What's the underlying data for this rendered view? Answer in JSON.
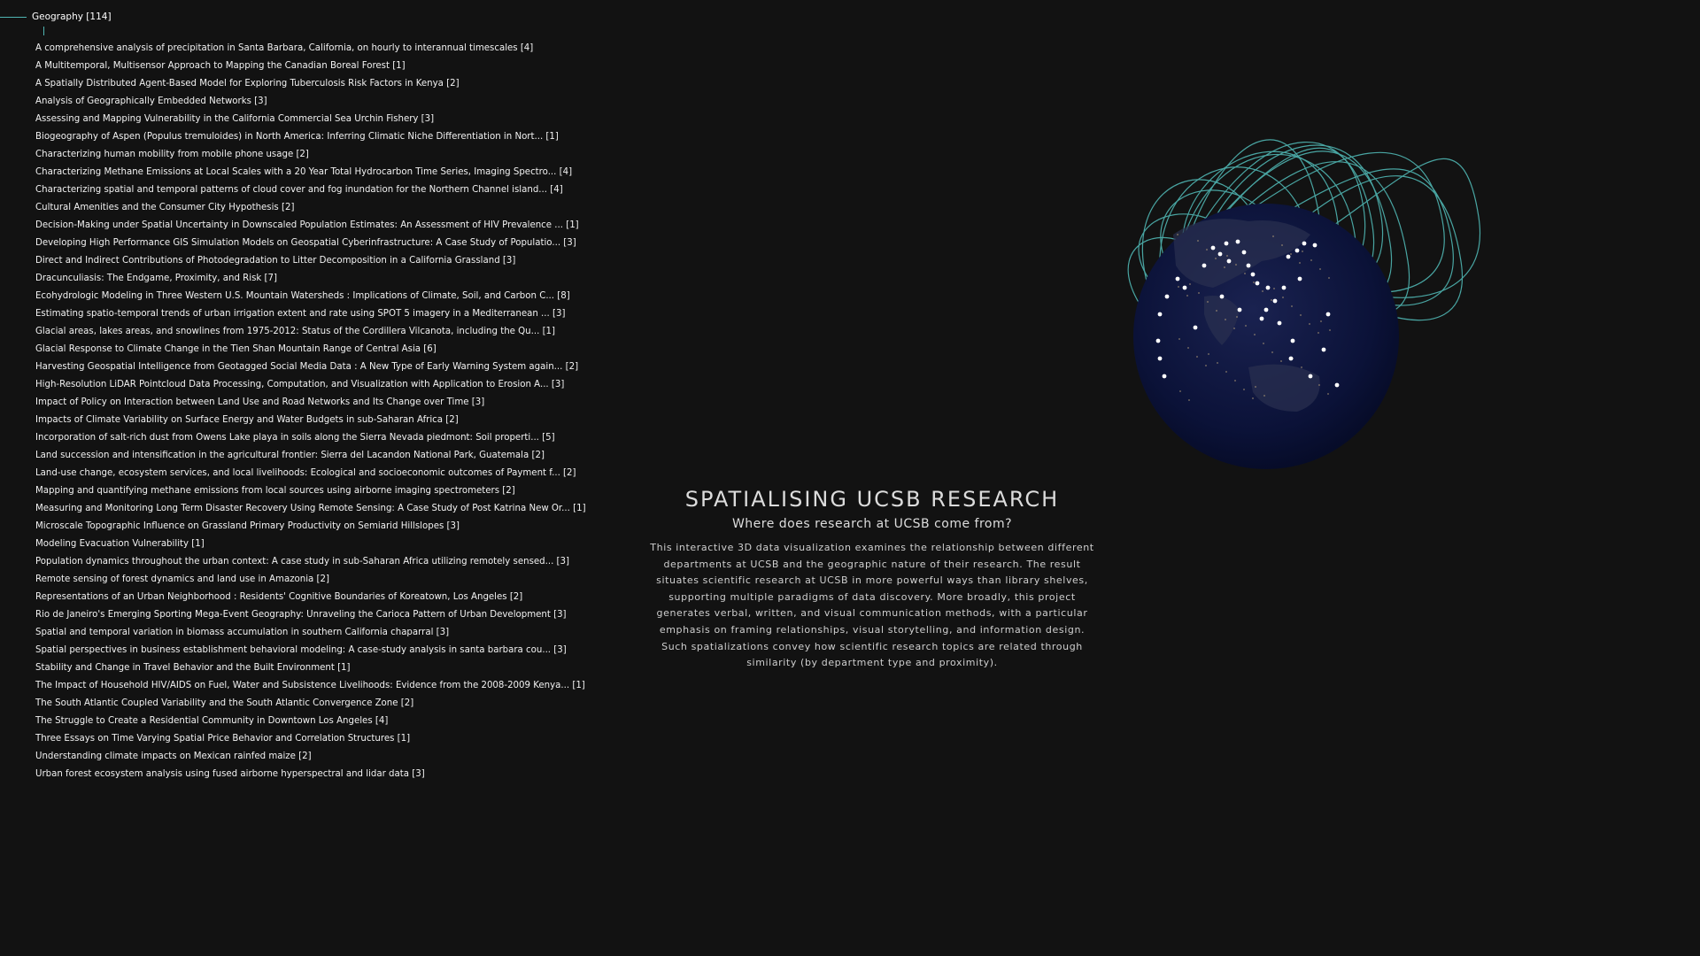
{
  "tree": {
    "header_label": "Geography [114]",
    "items": [
      "A comprehensive analysis of precipitation in Santa Barbara, California, on hourly to interannual timescales [4]",
      "A Multitemporal, Multisensor Approach to Mapping the Canadian Boreal Forest [1]",
      "A Spatially Distributed Agent-Based Model for Exploring Tuberculosis Risk Factors in Kenya [2]",
      "Analysis of Geographically Embedded Networks [3]",
      "Assessing and Mapping Vulnerability in the California Commercial Sea Urchin Fishery [3]",
      "Biogeography of Aspen (Populus tremuloides) in North America: Inferring Climatic Niche Differentiation in Nort... [1]",
      "Characterizing human mobility from mobile phone usage [2]",
      "Characterizing Methane Emissions at Local Scales with a 20 Year Total Hydrocarbon Time Series, Imaging Spectro... [4]",
      "Characterizing spatial and temporal patterns of cloud cover and fog inundation for the Northern Channel island... [4]",
      "Cultural Amenities and the Consumer City Hypothesis [2]",
      "Decision-Making under Spatial Uncertainty in Downscaled Population Estimates: An Assessment of HIV Prevalence ... [1]",
      "Developing High Performance GIS Simulation Models on Geospatial Cyberinfrastructure: A Case Study of Populatio... [3]",
      "Direct and Indirect Contributions of Photodegradation to Litter Decomposition in a California Grassland [3]",
      "Dracunculiasis: The Endgame, Proximity, and Risk [7]",
      "Ecohydrologic Modeling in Three Western U.S. Mountain Watersheds : Implications of Climate, Soil, and Carbon C... [8]",
      "Estimating spatio-temporal trends of urban irrigation extent and rate using SPOT 5 imagery in a Mediterranean ... [3]",
      "Glacial areas, lakes areas, and snowlines from 1975-2012: Status of the Cordillera Vilcanota, including the Qu... [1]",
      "Glacial Response to Climate Change in the Tien Shan Mountain Range of Central Asia [6]",
      "Harvesting Geospatial Intelligence from Geotagged Social Media Data : A New Type of Early Warning System again... [2]",
      "High-Resolution LiDAR Pointcloud Data Processing, Computation, and Visualization with Application to Erosion A... [3]",
      "Impact of Policy on Interaction between Land Use and Road Networks and Its Change over Time [3]",
      "Impacts of Climate Variability on Surface Energy and Water Budgets in sub-Saharan Africa [2]",
      "Incorporation of salt-rich dust from Owens Lake playa in soils along the Sierra Nevada piedmont: Soil properti... [5]",
      "Land succession and intensification in the agricultural frontier: Sierra del Lacandon National Park, Guatemala [2]",
      "Land-use change, ecosystem services, and local livelihoods: Ecological and socioeconomic outcomes of Payment f... [2]",
      "Mapping and quantifying methane emissions from local sources using airborne imaging spectrometers [2]",
      "Measuring and Monitoring Long Term Disaster Recovery Using Remote Sensing: A Case Study of Post Katrina New Or... [1]",
      "Microscale Topographic Influence on Grassland Primary Productivity on Semiarid Hillslopes [3]",
      "Modeling Evacuation Vulnerability [1]",
      "Population dynamics throughout the urban context: A case study in sub-Saharan Africa utilizing remotely sensed... [3]",
      "Remote sensing of forest dynamics and land use in Amazonia [2]",
      "Representations of an Urban Neighborhood : Residents' Cognitive Boundaries of Koreatown, Los Angeles [2]",
      "Rio de Janeiro's Emerging Sporting Mega-Event Geography: Unraveling the Carioca Pattern of Urban Development [3]",
      "Spatial and temporal variation in biomass accumulation in southern California chaparral [3]",
      "Spatial perspectives in business establishment behavioral modeling: A case-study analysis in santa barbara cou... [3]",
      "Stability and Change in Travel Behavior and the Built Environment [1]",
      "The Impact of Household HIV/AIDS on Fuel, Water and Subsistence Livelihoods: Evidence from the 2008-2009 Kenya... [1]",
      "The South Atlantic Coupled Variability and the South Atlantic Convergence Zone [2]",
      "The Struggle to Create a Residential Community in Downtown Los Angeles [4]",
      "Three Essays on Time Varying Spatial Price Behavior and Correlation Structures [1]",
      "Understanding climate impacts on Mexican rainfed maize [2]",
      "Urban forest ecosystem analysis using fused airborne hyperspectral and lidar data [3]"
    ]
  },
  "intro": {
    "title": "SPATIALISING UCSB RESEARCH",
    "subtitle": "Where does research at UCSB come from?",
    "description": "This interactive 3D data visualization examines the relationship between different departments at UCSB and the geographic nature of their research. The result situates scientific research at UCSB in more powerful ways than library shelves, supporting multiple paradigms of data discovery. More broadly, this project generates verbal, written, and visual communication methods, with a particular emphasis on framing relationships, visual storytelling, and information design. Such spatializations convey how scientific research topics are related through similarity (by department type and proximity)."
  },
  "colors": {
    "background": "#121212",
    "accent_teal": "#4fb5b2",
    "globe_ocean": "#0a1035",
    "city_lights": "#e8c98a",
    "points": "#ffffff"
  },
  "icons": {
    "globe": "globe-icon"
  }
}
